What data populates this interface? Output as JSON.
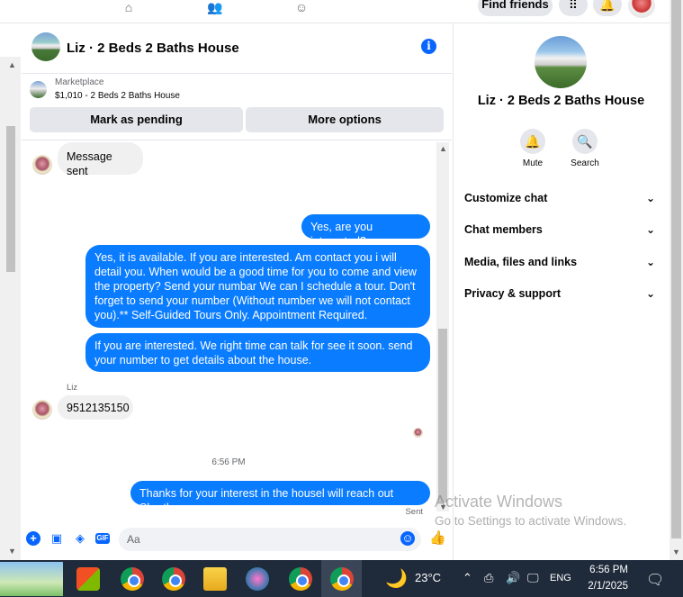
{
  "topbar": {
    "find_friends": "Find friends"
  },
  "chat": {
    "title": "Liz · 2 Beds 2 Baths House",
    "marketplace_label": "Marketplace",
    "listing": "$1,010 - 2 Beds 2 Baths House",
    "mark_pending": "Mark as pending",
    "more_options": "More options"
  },
  "messages": {
    "sent_notice": "Message sent",
    "out1": "Yes, are you interested?",
    "out2": "Yes, it is available. If you are interested.  Am contact you i will detail you.  When would be a good time for you to come and view the property? Send your numbar We can I schedule a tour.  Don't forget to send your number (Without number we will not contact you).** Self-Guided Tours Only. Appointment Required.",
    "out3": "If you are interested. We right time can talk for see it soon. send your number to get details about the house.",
    "sender_name": "Liz",
    "in_number": "9512135150",
    "timestamp": "6:56 PM",
    "out4": "Thanks for your interest in the housel will reach out Shortly.",
    "status": "Sent"
  },
  "composer": {
    "placeholder": "Aa"
  },
  "right_panel": {
    "title": "Liz · 2 Beds 2 Baths House",
    "mute": "Mute",
    "search": "Search",
    "rows": [
      "Customize chat",
      "Chat members",
      "Media, files and links",
      "Privacy & support"
    ]
  },
  "watermark": {
    "line1": "Activate Windows",
    "line2": "Go to Settings to activate Windows."
  },
  "taskbar": {
    "temperature": "23°C",
    "lang": "ENG",
    "time": "6:56 PM",
    "date": "2/1/2025"
  },
  "colors": {
    "accent": "#0866ff",
    "bubble_out": "#0a7cff",
    "bubble_in": "#f0f0f0"
  }
}
